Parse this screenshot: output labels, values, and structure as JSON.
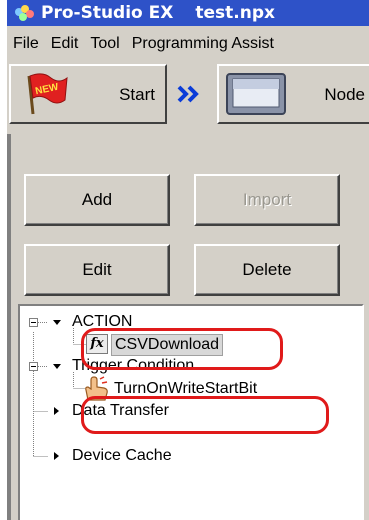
{
  "window": {
    "app_name": "Pro-Studio EX",
    "file_name": "test.npx"
  },
  "menu": [
    "File",
    "Edit",
    "Tool",
    "Programming Assist"
  ],
  "toolbar": {
    "start_label": "Start",
    "start_badge": "NEW",
    "node_label": "Node"
  },
  "buttons": {
    "add": "Add",
    "import": "Import",
    "edit": "Edit",
    "delete": "Delete"
  },
  "tree": {
    "action": "ACTION",
    "action_child": "CSVDownload",
    "trigger": "Trigger Condition",
    "trigger_child": "TurnOnWriteStartBit",
    "data_transfer": "Data Transfer",
    "device_cache": "Device Cache"
  },
  "icons": {
    "fx": "fx"
  },
  "colors": {
    "title_bar": "#2e52c8",
    "highlight": "#e01a1a",
    "face": "#d4d0c8"
  }
}
